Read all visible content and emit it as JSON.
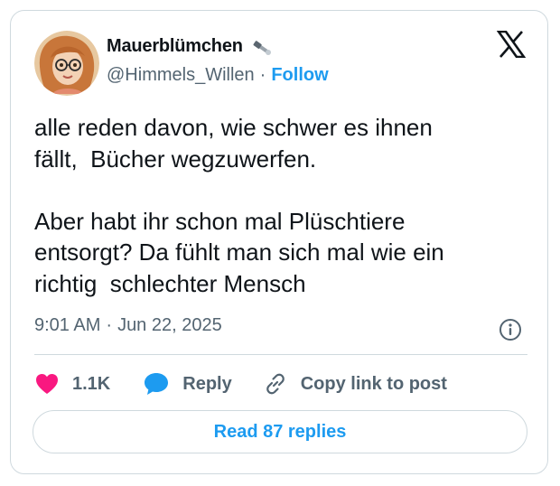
{
  "author": {
    "display_name": "Mauerblümchen",
    "handle": "@Himmels_Willen",
    "separator": "·",
    "follow_label": "Follow",
    "avatar_icon": "cartoon-girl-with-glasses-avatar",
    "badge_icon": "tools-icon"
  },
  "tweet": {
    "text": "alle reden davon, wie schwer es ihnen\nfällt,  Bücher wegzuwerfen.\n\nAber habt ihr schon mal Plüschtiere\nentsorgt? Da fühlt man sich mal wie ein\nrichtig  schlechter Mensch",
    "time": "9:01 AM",
    "separator": "·",
    "date": "Jun 22, 2025"
  },
  "actions": {
    "like_count": "1.1K",
    "reply_label": "Reply",
    "copy_link_label": "Copy link to post"
  },
  "footer": {
    "read_replies_label": "Read 87 replies"
  },
  "colors": {
    "accent": "#1d9bf0",
    "like": "#f91880",
    "muted": "#536471",
    "border": "#cfd9de"
  }
}
